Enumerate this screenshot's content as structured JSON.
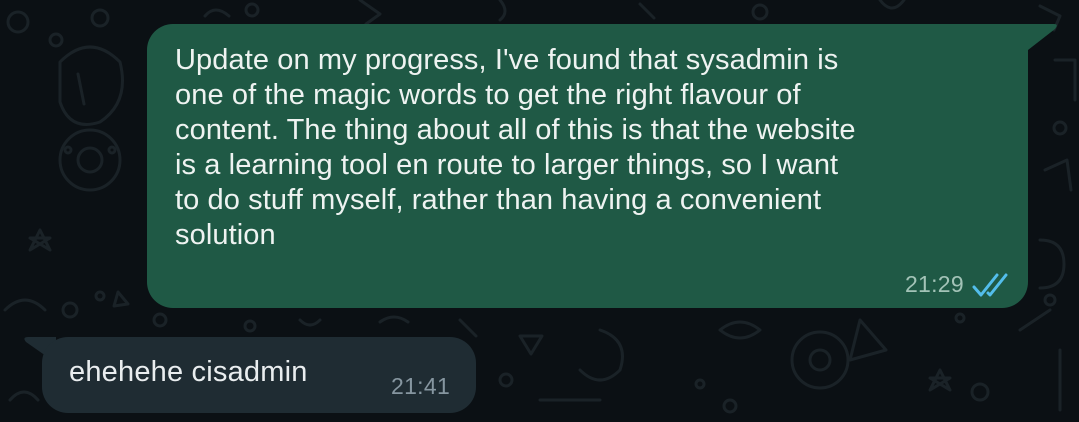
{
  "colors": {
    "chat_background": "#0b1014",
    "outgoing_bubble": "#1f5945",
    "incoming_bubble": "#1f2c33",
    "read_ticks": "#53bdeb"
  },
  "messages": [
    {
      "direction": "outgoing",
      "text": "Update on my progress, I've found that sysadmin is\none of the magic words to get the right flavour of\ncontent. The thing about all of this is that the website\nis a learning tool en route to larger things, so I want\nto do stuff myself, rather than having a convenient\nsolution",
      "time": "21:29",
      "status_icon": "double-check-read-icon"
    },
    {
      "direction": "incoming",
      "text": "ehehehe cisadmin",
      "time": "21:41"
    }
  ]
}
